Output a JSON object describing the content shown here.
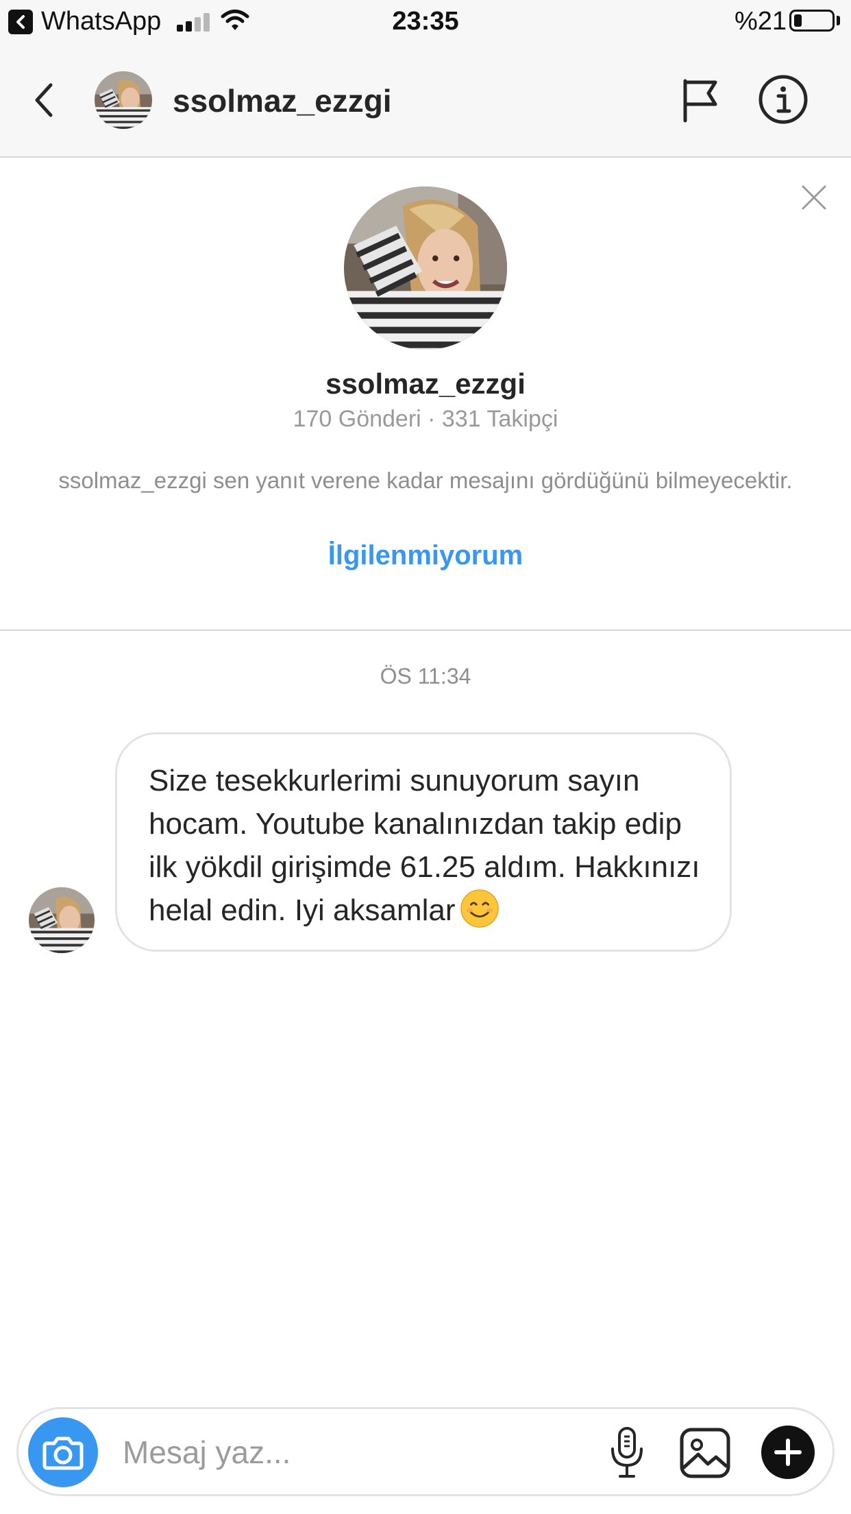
{
  "status_bar": {
    "back_app": "WhatsApp",
    "time": "23:35",
    "battery": "%21",
    "battery_level": 0.21,
    "signal_bars": 2,
    "icons": [
      "back-to-app-icon",
      "signal-icon",
      "wifi-icon",
      "battery-icon"
    ]
  },
  "header": {
    "username": "ssolmaz_ezzgi",
    "icons": [
      "back-icon",
      "avatar",
      "flag-icon",
      "info-icon"
    ]
  },
  "profile": {
    "username": "ssolmaz_ezzgi",
    "stats": "170 Gönderi · 331 Takipçi",
    "notice": "ssolmaz_ezzgi sen yanıt verene kadar mesajını gördüğünü bilmeyecektir.",
    "not_interested_label": "İlgilenmiyorum",
    "accent_color": "#3897f0"
  },
  "conversation": {
    "timestamp": "ÖS 11:34",
    "messages": [
      {
        "text": "Size tesekkurlerimi sunuyorum sayın hocam. Youtube kanalınızdan takip edip ilk yökdil girişimde 61.25 aldım. Hakkınızı helal edin. Iyi aksamlar",
        "emoji": "smiling-face-icon"
      }
    ]
  },
  "composer": {
    "placeholder": "Mesaj yaz...",
    "value": "",
    "icons": [
      "camera-icon",
      "microphone-icon",
      "gallery-icon",
      "plus-icon"
    ]
  }
}
